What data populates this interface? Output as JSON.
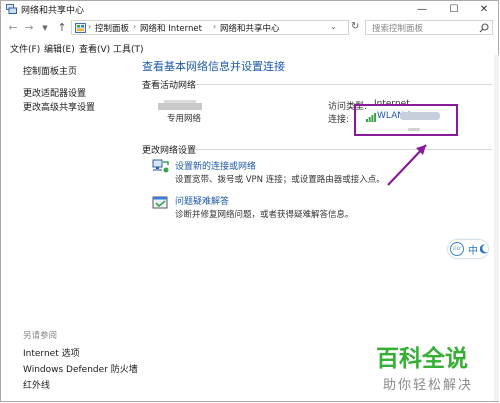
{
  "window": {
    "title": "网络和共享中心",
    "controls": {
      "minimize": "—",
      "maximize": "☐",
      "close": "✕"
    }
  },
  "address_bar": {
    "breadcrumbs": [
      "控制面板",
      "网络和 Internet",
      "网络和共享中心"
    ],
    "search_placeholder": "搜索控制面板"
  },
  "menu": {
    "items": [
      "文件(F)",
      "编辑(E)",
      "查看(V)",
      "工具(T)"
    ]
  },
  "sidebar": {
    "links": [
      "控制面板主页",
      "更改适配器设置",
      "更改高级共享设置"
    ],
    "see_also_label": "另请参阅",
    "see_also_links": [
      "Internet 选项",
      "Windows Defender 防火墙",
      "红外线"
    ]
  },
  "main": {
    "title": "查看基本网络信息并设置连接",
    "active_networks_label": "查看活动网络",
    "network_type": "专用网络",
    "access_type_label": "访问类型:",
    "access_type_value": "Internet",
    "connections_label": "连接:",
    "connection_name": "WLAN (",
    "change_settings_label": "更改网络设置",
    "tasks": [
      {
        "title": "设置新的连接或网络",
        "desc": "设置宽带、拨号或 VPN 连接；或设置路由器或接入点。"
      },
      {
        "title": "问题疑难解答",
        "desc": "诊断并修复网络问题，或者获得疑难解答信息。"
      }
    ]
  },
  "overlay": {
    "ime_label": "中",
    "ime_brand": "iFLY",
    "watermark_title": "百科全说",
    "watermark_subtitle": "助你轻松解决",
    "annotation_color": "#8a1a9b"
  },
  "colors": {
    "link": "#1e5aa8",
    "watermark_green": "#35b035"
  }
}
